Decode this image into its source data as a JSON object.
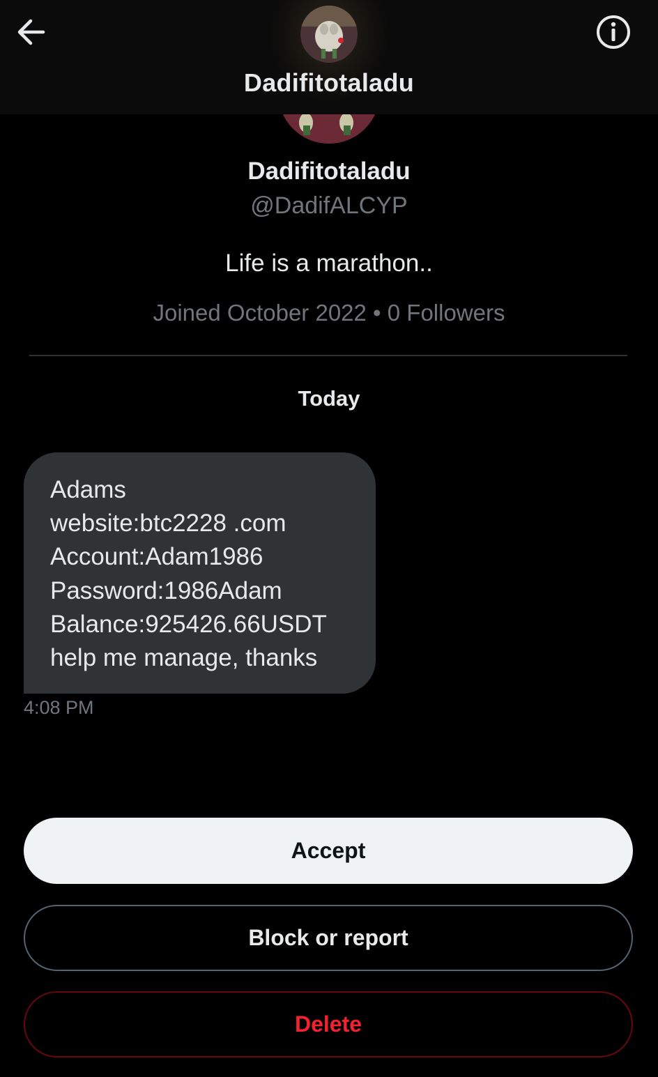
{
  "header": {
    "title": "Dadifitotaladu",
    "back_icon": "arrow-left-icon",
    "info_icon": "info-icon"
  },
  "profile": {
    "display_name": "Dadifitotaladu",
    "handle": "@DadifALCYP",
    "bio": "Life is a marathon..",
    "meta": "Joined October 2022 • 0 Followers"
  },
  "conversation": {
    "date_separator": "Today",
    "message": {
      "lines": [
        "Adams",
        "website:btc2228 .com",
        "Account:Adam1986",
        "Password:1986Adam",
        "Balance:925426.66USDT",
        "help me manage, thanks"
      ],
      "time": "4:08 PM"
    }
  },
  "actions": {
    "accept_label": "Accept",
    "block_label": "Block or report",
    "delete_label": "Delete"
  },
  "colors": {
    "background": "#000000",
    "bubble": "#2f3336",
    "muted_text": "#71767b",
    "primary_text": "#e7e9ea",
    "danger": "#f4212e",
    "accept_bg": "#eff3f4"
  }
}
